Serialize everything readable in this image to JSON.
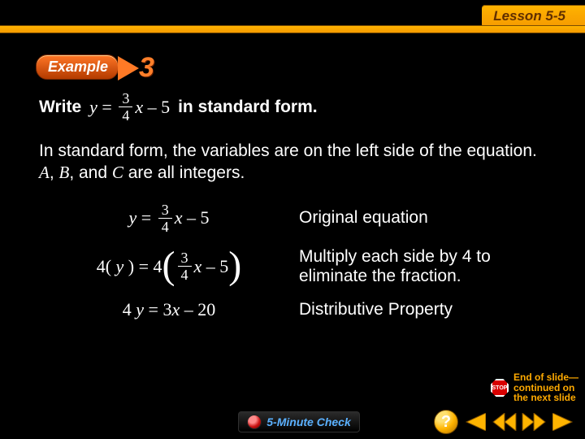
{
  "lesson": {
    "label": "Lesson 5-5"
  },
  "example": {
    "label": "Example",
    "number": "3"
  },
  "problem": {
    "prefix": "Write",
    "eq_lhs": "y",
    "eq_rhs_coeff_num": "3",
    "eq_rhs_coeff_den": "4",
    "eq_rhs_var": "x",
    "eq_rhs_const": "– 5",
    "suffix": "in standard form."
  },
  "explanation": {
    "text_a": "In standard form, the variables are on the left side of the equation. ",
    "var_a": "A",
    "sep1": ", ",
    "var_b": "B",
    "sep2": ", and ",
    "var_c": "C",
    "text_b": " are all integers."
  },
  "steps": [
    {
      "eq": {
        "lhs": "y",
        "coeff_num": "3",
        "coeff_den": "4",
        "var": "x",
        "const": "– 5",
        "prefix": "",
        "paren": false
      },
      "label": "Original equation"
    },
    {
      "eq": {
        "lhs": "4( y )",
        "coeff_num": "3",
        "coeff_den": "4",
        "var": "x",
        "const": "– 5",
        "prefix": "4",
        "paren": true
      },
      "label": "Multiply each side by 4 to eliminate the fraction."
    },
    {
      "eq": {
        "plain": "4 y = 3x – 20"
      },
      "label": "Distributive Property"
    }
  ],
  "end_note": {
    "stop": "STOP",
    "line1": "End of slide—",
    "line2": "continued on",
    "line3": "the next slide"
  },
  "footer": {
    "five_min": "5-Minute Check",
    "help": "?",
    "nav": {
      "prev": "prev",
      "rewind": "rewind",
      "forward": "forward",
      "next": "next"
    }
  },
  "colors": {
    "accent": "#ffb400",
    "brand": "#ff7a26",
    "link": "#5bb1ff"
  }
}
